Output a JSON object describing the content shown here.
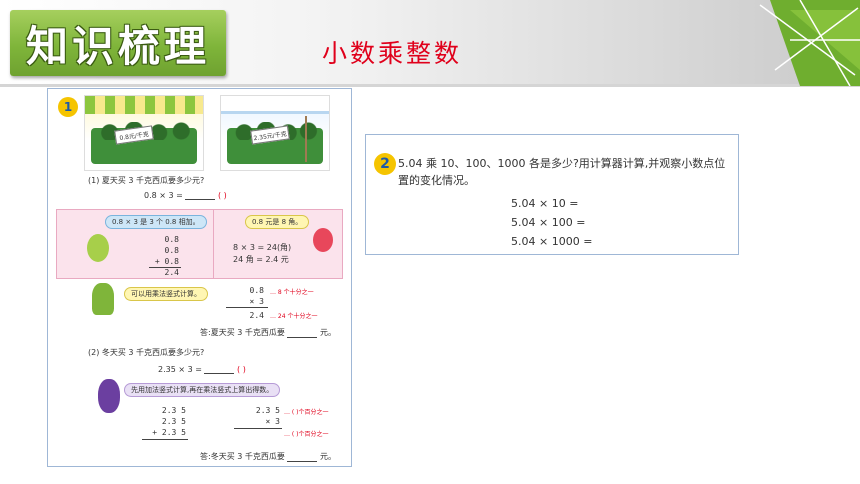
{
  "header": {
    "badge": "知识梳理",
    "topic": "小数乘整数"
  },
  "colors": {
    "accent_green": "#7fb53a",
    "title_red": "#e0001b",
    "badge_yellow": "#f5c400"
  },
  "left_panel": {
    "badge_number": "1",
    "price_tags": [
      "0.8元/千克",
      "2.35元/千克"
    ],
    "q1": {
      "text": "(1) 夏天买 3 千克西瓜要多少元?",
      "equation": "0.8 × 3 =",
      "paren": "(    )",
      "bubble_left": "0.8 × 3 是 3 个 0.8 相加。",
      "addition": [
        "0.8",
        "0.8",
        "+ 0.8",
        "2.4"
      ],
      "bubble_right": "0.8 元是 8 角。",
      "angle_lines": [
        "8 × 3 = 24(角)",
        "24 角 = 2.4 元"
      ],
      "bubble_vertical": "可以用乘法竖式计算。",
      "vertical": [
        "0.8",
        "×   3",
        "2.4"
      ],
      "notes": [
        "… 8 个十分之一",
        "… 24 个十分之一"
      ],
      "answer": "答:夏天买 3 千克西瓜要",
      "unit": "元。"
    },
    "q2": {
      "text": "(2) 冬天买 3 千克西瓜要多少元?",
      "equation": "2.35 × 3 =",
      "paren": "(    )",
      "bubble": "先用加法竖式计算,再在乘法竖式上算出得数。",
      "addition": [
        "2.3 5",
        "2.3 5",
        "+ 2.3 5"
      ],
      "vertical": [
        "2.3 5",
        "×     3"
      ],
      "notes": [
        "… (    )个百分之一",
        "… (    )个百分之一"
      ],
      "answer": "答:冬天买 3 千克西瓜要",
      "unit": "元。"
    }
  },
  "right_panel": {
    "badge_number": "2",
    "question": "5.04 乘 10、100、1000 各是多少?用计算器计算,并观察小数点位置的变化情况。",
    "calcs": [
      "5.04 × 10 =",
      "5.04 × 100 =",
      "5.04 × 1000 ="
    ]
  }
}
